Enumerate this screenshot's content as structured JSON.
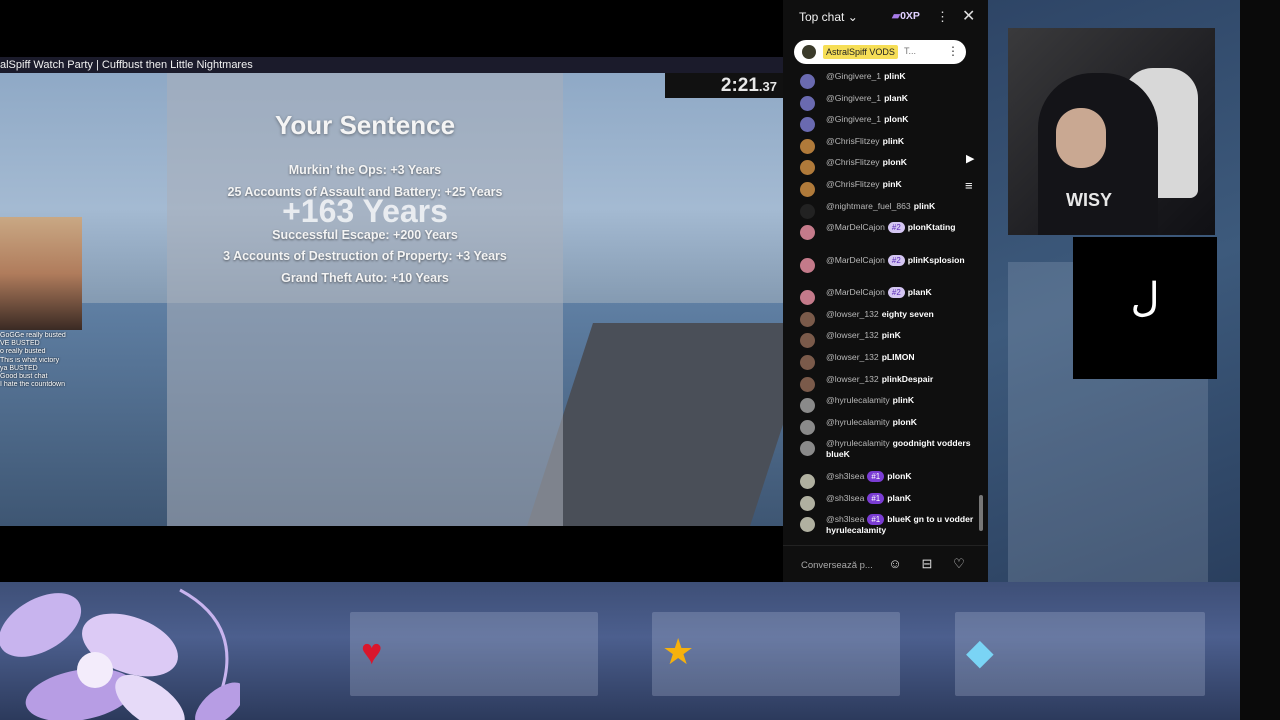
{
  "stream": {
    "title": "alSpiff Watch Party | Cuffbust then Little Nightmares"
  },
  "game": {
    "sentence_title": "Your Sentence",
    "sentence_lines": [
      "Murkin' the Ops: +3 Years",
      "25 Accounts of Assault and Battery: +25 Years",
      "",
      "Successful Escape: +200 Years",
      "3 Accounts of Destruction of Property: +3 Years",
      "Grand Theft Auto: +10 Years"
    ],
    "total": "+163 Years",
    "timer_main": "2:21",
    "timer_ms": ".37"
  },
  "overlay_chat": [
    "GoGGe  really busted",
    "",
    "VE BUSTED",
    "o really busted",
    "  This is what victory",
    "",
    "ya  BUSTED",
    "   Good bust chat",
    "      I hate the countdown"
  ],
  "chat": {
    "mode": "Top chat",
    "xp": "0XP",
    "pinned_name": "AstralSpiff VODS",
    "pinned_more": "T...",
    "messages": [
      {
        "author": "@Gingivere_1",
        "text": "plinK",
        "badge": "",
        "color": "#6a6ab0"
      },
      {
        "author": "@Gingivere_1",
        "text": "planK",
        "badge": "",
        "color": "#6a6ab0"
      },
      {
        "author": "@Gingivere_1",
        "text": "plonK",
        "badge": "",
        "color": "#6a6ab0"
      },
      {
        "author": "@ChrisFlitzey",
        "text": "plinK",
        "badge": "",
        "color": "#b07a3a"
      },
      {
        "author": "@ChrisFlitzey",
        "text": "plonK",
        "badge": "",
        "color": "#b07a3a"
      },
      {
        "author": "@ChrisFlitzey",
        "text": "pinK",
        "badge": "",
        "color": "#b07a3a"
      },
      {
        "author": "@nightmare_fuel_863",
        "text": "plinK",
        "badge": "",
        "color": "#222222"
      },
      {
        "author": "@MarDelCajon",
        "text": "plonKtating",
        "badge": "#2",
        "color": "#c47a8a"
      },
      {
        "author": "@MarDelCajon",
        "text": "plinKsplosion",
        "badge": "#2",
        "color": "#c47a8a"
      },
      {
        "author": "@MarDelCajon",
        "text": "planK",
        "badge": "#2",
        "color": "#c47a8a"
      },
      {
        "author": "@lowser_132",
        "text": "eighty seven",
        "badge": "",
        "color": "#7a5a4a"
      },
      {
        "author": "@lowser_132",
        "text": "pinK",
        "badge": "",
        "color": "#7a5a4a"
      },
      {
        "author": "@lowser_132",
        "text": "pLIMON",
        "badge": "",
        "color": "#7a5a4a"
      },
      {
        "author": "@lowser_132",
        "text": "plinkDespair",
        "badge": "",
        "color": "#7a5a4a"
      },
      {
        "author": "@hyrulecalamity",
        "text": "plinK",
        "badge": "",
        "color": "#8a8a8a"
      },
      {
        "author": "@hyrulecalamity",
        "text": "plonK",
        "badge": "",
        "color": "#8a8a8a"
      },
      {
        "author": "@hyrulecalamity",
        "text": "goodnight vodders blueK",
        "badge": "",
        "color": "#8a8a8a"
      },
      {
        "author": "@sh3lsea",
        "text": "plonK",
        "badge": "#1",
        "color": "#b0b0a0"
      },
      {
        "author": "@sh3lsea",
        "text": "planK",
        "badge": "#1",
        "color": "#b0b0a0"
      },
      {
        "author": "@sh3lsea",
        "text": "blueK gn to u vodder hyrulecalamity",
        "badge": "#1",
        "color": "#b0b0a0"
      }
    ],
    "input_placeholder": "Conversează p..."
  },
  "icons": {
    "close": "close-icon",
    "more": "more-vert-icon",
    "chevron": "chevron-down-icon",
    "emoji": "emoji-icon",
    "dollar": "super-chat-icon",
    "heart": "heart-icon",
    "play": "play-icon",
    "menu": "menu-icon"
  },
  "colors": {
    "accent_purple": "#7a3cd3",
    "pinned_highlight": "#f6de56",
    "chat_bg": "#0f0f0f"
  },
  "facecam": {
    "shirt_text": "WISY",
    "glyph": "ل"
  }
}
